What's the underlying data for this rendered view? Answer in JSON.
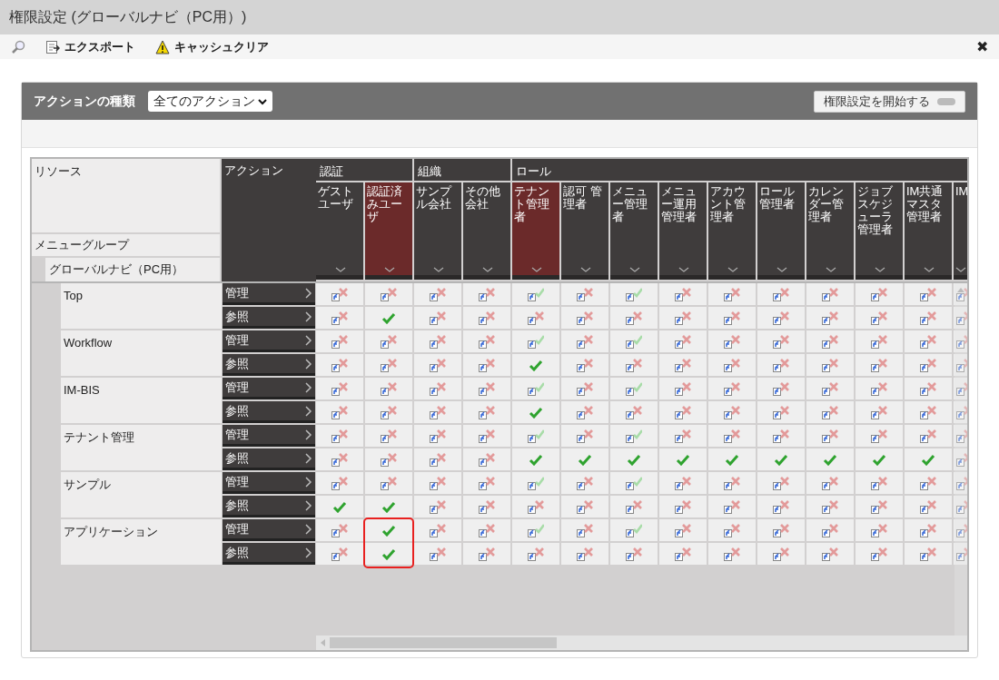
{
  "window": {
    "title": "権限設定 (グローバルナビ（PC用）)",
    "close": "✖"
  },
  "toolbar": [
    {
      "kind": "search"
    },
    {
      "kind": "export",
      "label": "エクスポート"
    },
    {
      "kind": "warning",
      "label": "キャッシュクリア"
    }
  ],
  "panel": {
    "filter_label": "アクションの種類",
    "filter_value": "全てのアクション",
    "start_button": "権限設定を開始する",
    "start_on": false
  },
  "grid": {
    "resource_header": "リソース",
    "action_header": "アクション",
    "group_header": "メニューグループ",
    "group": "グローバルナビ（PC用）",
    "column_groups": [
      {
        "label": "認証",
        "columns": [
          {
            "label": "ゲストユーザ",
            "highlighted": false
          },
          {
            "label": "認証済みユーザ",
            "highlighted": true
          }
        ]
      },
      {
        "label": "組織",
        "columns": [
          {
            "label": "サンプル会社",
            "highlighted": false
          },
          {
            "label": "その他会社",
            "highlighted": false
          }
        ]
      },
      {
        "label": "ロール",
        "columns": [
          {
            "label": "テナント管理者",
            "highlighted": true
          },
          {
            "label": "認可 管理者",
            "highlighted": false
          },
          {
            "label": "メニュー管理者",
            "highlighted": false
          },
          {
            "label": "メニュー運用管理者",
            "highlighted": false
          },
          {
            "label": "アカウント管理者",
            "highlighted": false
          },
          {
            "label": "ロール管理者",
            "highlighted": false
          },
          {
            "label": "カレンダー管理者",
            "highlighted": false
          },
          {
            "label": "ジョブスケジューラ管理者",
            "highlighted": false
          },
          {
            "label": "IM共通マスタ管理者",
            "highlighted": false
          },
          {
            "label": "IM",
            "highlighted": false
          }
        ]
      }
    ],
    "rows": [
      {
        "resource": "Top",
        "actions": [
          {
            "label": "管理",
            "cells": [
              {
                "kind": "deny_inherited"
              },
              {
                "kind": "deny_inherited"
              },
              {
                "kind": "deny_inherited"
              },
              {
                "kind": "deny_inherited"
              },
              {
                "kind": "allow_inherited"
              },
              {
                "kind": "deny_inherited"
              },
              {
                "kind": "allow_inherited"
              },
              {
                "kind": "deny_inherited"
              },
              {
                "kind": "deny_inherited"
              },
              {
                "kind": "deny_inherited"
              },
              {
                "kind": "deny_inherited"
              },
              {
                "kind": "deny_inherited"
              },
              {
                "kind": "deny_inherited"
              },
              {
                "kind": "deny_inherited"
              }
            ]
          },
          {
            "label": "参照",
            "cells": [
              {
                "kind": "deny_inherited"
              },
              {
                "kind": "allow"
              },
              {
                "kind": "deny_inherited"
              },
              {
                "kind": "deny_inherited"
              },
              {
                "kind": "deny_inherited"
              },
              {
                "kind": "deny_inherited"
              },
              {
                "kind": "deny_inherited"
              },
              {
                "kind": "deny_inherited"
              },
              {
                "kind": "deny_inherited"
              },
              {
                "kind": "deny_inherited"
              },
              {
                "kind": "deny_inherited"
              },
              {
                "kind": "deny_inherited"
              },
              {
                "kind": "deny_inherited"
              },
              {
                "kind": "deny_inherited"
              }
            ]
          }
        ]
      },
      {
        "resource": "Workflow",
        "actions": [
          {
            "label": "管理",
            "cells": [
              {
                "kind": "deny_inherited"
              },
              {
                "kind": "deny_inherited"
              },
              {
                "kind": "deny_inherited"
              },
              {
                "kind": "deny_inherited"
              },
              {
                "kind": "allow_inherited"
              },
              {
                "kind": "deny_inherited"
              },
              {
                "kind": "allow_inherited"
              },
              {
                "kind": "deny_inherited"
              },
              {
                "kind": "deny_inherited"
              },
              {
                "kind": "deny_inherited"
              },
              {
                "kind": "deny_inherited"
              },
              {
                "kind": "deny_inherited"
              },
              {
                "kind": "deny_inherited"
              },
              {
                "kind": "deny_inherited"
              }
            ]
          },
          {
            "label": "参照",
            "cells": [
              {
                "kind": "deny_inherited"
              },
              {
                "kind": "deny_inherited"
              },
              {
                "kind": "deny_inherited"
              },
              {
                "kind": "deny_inherited"
              },
              {
                "kind": "allow"
              },
              {
                "kind": "deny_inherited"
              },
              {
                "kind": "deny_inherited"
              },
              {
                "kind": "deny_inherited"
              },
              {
                "kind": "deny_inherited"
              },
              {
                "kind": "deny_inherited"
              },
              {
                "kind": "deny_inherited"
              },
              {
                "kind": "deny_inherited"
              },
              {
                "kind": "deny_inherited"
              },
              {
                "kind": "deny_inherited"
              }
            ]
          }
        ]
      },
      {
        "resource": "IM-BIS",
        "actions": [
          {
            "label": "管理",
            "cells": [
              {
                "kind": "deny_inherited"
              },
              {
                "kind": "deny_inherited"
              },
              {
                "kind": "deny_inherited"
              },
              {
                "kind": "deny_inherited"
              },
              {
                "kind": "allow_inherited"
              },
              {
                "kind": "deny_inherited"
              },
              {
                "kind": "allow_inherited"
              },
              {
                "kind": "deny_inherited"
              },
              {
                "kind": "deny_inherited"
              },
              {
                "kind": "deny_inherited"
              },
              {
                "kind": "deny_inherited"
              },
              {
                "kind": "deny_inherited"
              },
              {
                "kind": "deny_inherited"
              },
              {
                "kind": "deny_inherited"
              }
            ]
          },
          {
            "label": "参照",
            "cells": [
              {
                "kind": "deny_inherited"
              },
              {
                "kind": "deny_inherited"
              },
              {
                "kind": "deny_inherited"
              },
              {
                "kind": "deny_inherited"
              },
              {
                "kind": "allow"
              },
              {
                "kind": "deny_inherited"
              },
              {
                "kind": "deny_inherited"
              },
              {
                "kind": "deny_inherited"
              },
              {
                "kind": "deny_inherited"
              },
              {
                "kind": "deny_inherited"
              },
              {
                "kind": "deny_inherited"
              },
              {
                "kind": "deny_inherited"
              },
              {
                "kind": "deny_inherited"
              },
              {
                "kind": "deny_inherited"
              }
            ]
          }
        ]
      },
      {
        "resource": "テナント管理",
        "actions": [
          {
            "label": "管理",
            "cells": [
              {
                "kind": "deny_inherited"
              },
              {
                "kind": "deny_inherited"
              },
              {
                "kind": "deny_inherited"
              },
              {
                "kind": "deny_inherited"
              },
              {
                "kind": "allow_inherited"
              },
              {
                "kind": "deny_inherited"
              },
              {
                "kind": "allow_inherited"
              },
              {
                "kind": "deny_inherited"
              },
              {
                "kind": "deny_inherited"
              },
              {
                "kind": "deny_inherited"
              },
              {
                "kind": "deny_inherited"
              },
              {
                "kind": "deny_inherited"
              },
              {
                "kind": "deny_inherited"
              },
              {
                "kind": "deny_inherited"
              }
            ]
          },
          {
            "label": "参照",
            "cells": [
              {
                "kind": "deny_inherited"
              },
              {
                "kind": "deny_inherited"
              },
              {
                "kind": "deny_inherited"
              },
              {
                "kind": "deny_inherited"
              },
              {
                "kind": "allow"
              },
              {
                "kind": "allow"
              },
              {
                "kind": "allow"
              },
              {
                "kind": "allow"
              },
              {
                "kind": "allow"
              },
              {
                "kind": "allow"
              },
              {
                "kind": "allow"
              },
              {
                "kind": "allow"
              },
              {
                "kind": "allow"
              },
              {
                "kind": "deny_inherited"
              }
            ]
          }
        ]
      },
      {
        "resource": "サンプル",
        "actions": [
          {
            "label": "管理",
            "cells": [
              {
                "kind": "deny_inherited"
              },
              {
                "kind": "deny_inherited"
              },
              {
                "kind": "deny_inherited"
              },
              {
                "kind": "deny_inherited"
              },
              {
                "kind": "allow_inherited"
              },
              {
                "kind": "deny_inherited"
              },
              {
                "kind": "allow_inherited"
              },
              {
                "kind": "deny_inherited"
              },
              {
                "kind": "deny_inherited"
              },
              {
                "kind": "deny_inherited"
              },
              {
                "kind": "deny_inherited"
              },
              {
                "kind": "deny_inherited"
              },
              {
                "kind": "deny_inherited"
              },
              {
                "kind": "deny_inherited"
              }
            ]
          },
          {
            "label": "参照",
            "cells": [
              {
                "kind": "allow"
              },
              {
                "kind": "allow"
              },
              {
                "kind": "deny_inherited"
              },
              {
                "kind": "deny_inherited"
              },
              {
                "kind": "deny_inherited"
              },
              {
                "kind": "deny_inherited"
              },
              {
                "kind": "deny_inherited"
              },
              {
                "kind": "deny_inherited"
              },
              {
                "kind": "deny_inherited"
              },
              {
                "kind": "deny_inherited"
              },
              {
                "kind": "deny_inherited"
              },
              {
                "kind": "deny_inherited"
              },
              {
                "kind": "deny_inherited"
              },
              {
                "kind": "deny_inherited"
              }
            ]
          }
        ]
      },
      {
        "resource": "アプリケーション",
        "actions": [
          {
            "label": "管理",
            "cells": [
              {
                "kind": "deny_inherited"
              },
              {
                "kind": "allow",
                "outlined": true
              },
              {
                "kind": "deny_inherited"
              },
              {
                "kind": "deny_inherited"
              },
              {
                "kind": "allow_inherited"
              },
              {
                "kind": "deny_inherited"
              },
              {
                "kind": "allow_inherited"
              },
              {
                "kind": "deny_inherited"
              },
              {
                "kind": "deny_inherited"
              },
              {
                "kind": "deny_inherited"
              },
              {
                "kind": "deny_inherited"
              },
              {
                "kind": "deny_inherited"
              },
              {
                "kind": "deny_inherited"
              },
              {
                "kind": "deny_inherited"
              }
            ]
          },
          {
            "label": "参照",
            "cells": [
              {
                "kind": "deny_inherited"
              },
              {
                "kind": "allow",
                "outlined": true
              },
              {
                "kind": "deny_inherited"
              },
              {
                "kind": "deny_inherited"
              },
              {
                "kind": "deny_inherited"
              },
              {
                "kind": "deny_inherited"
              },
              {
                "kind": "deny_inherited"
              },
              {
                "kind": "deny_inherited"
              },
              {
                "kind": "deny_inherited"
              },
              {
                "kind": "deny_inherited"
              },
              {
                "kind": "deny_inherited"
              },
              {
                "kind": "deny_inherited"
              },
              {
                "kind": "deny_inherited"
              },
              {
                "kind": "deny_inherited"
              }
            ]
          }
        ]
      }
    ]
  }
}
